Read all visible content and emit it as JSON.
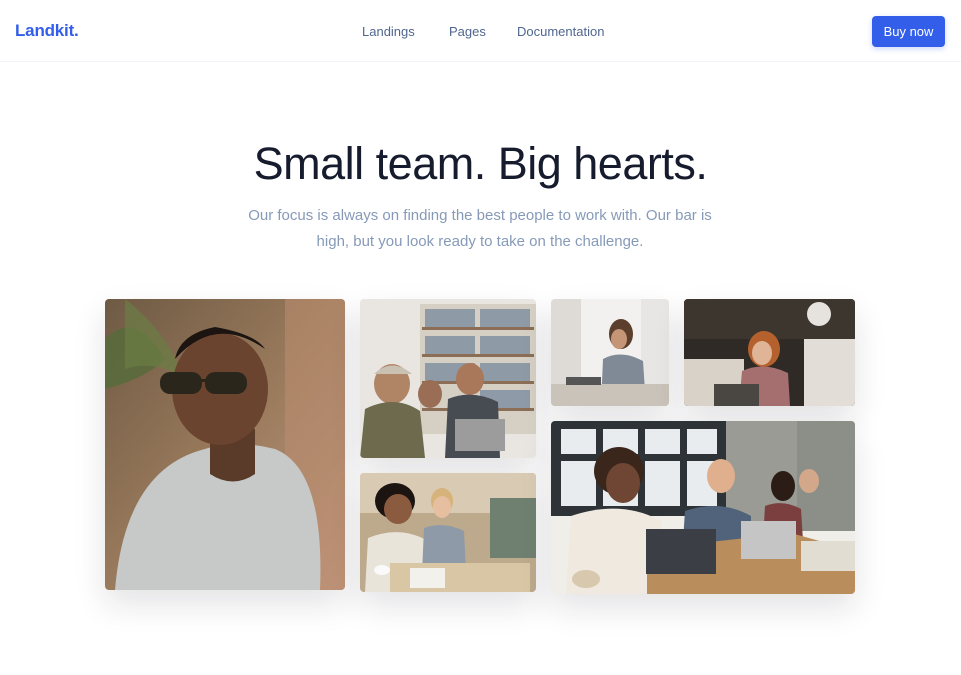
{
  "navbar": {
    "brand": "Landkit.",
    "links": [
      "Landings",
      "Pages",
      "Documentation"
    ],
    "cta_label": "Buy now"
  },
  "hero": {
    "title": "Small team. Big hearts.",
    "subtitle": "Our focus is always on finding the best people to work with. Our bar is high, but you look ready to take on the challenge."
  },
  "colors": {
    "brand": "#335eea",
    "heading": "#161c2d",
    "muted": "#869ab8",
    "nav": "#506690"
  },
  "gallery": {
    "images": [
      "portrait-man-sunglasses-photo",
      "team-bookshelf-photo",
      "woman-window-photo",
      "woman-cafe-laptop-photo",
      "women-laughing-meeting-photo",
      "team-office-laptops-photo"
    ]
  }
}
